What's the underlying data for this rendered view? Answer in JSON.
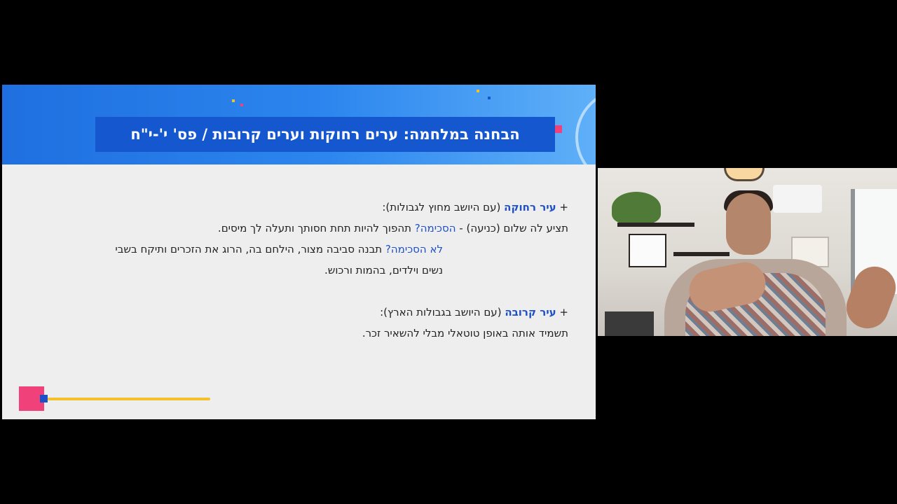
{
  "slide": {
    "title": "הבחנה במלחמה: ערים רחוקות וערים קרובות / פס' י'-י\"ח",
    "lines": [
      {
        "bold": "עיר רחוקה",
        "text": " (עם היושב מחוץ לגבולות):",
        "prefix": "+ "
      },
      {
        "text": "תציע לה שלום (כניעה)  - ",
        "blue": "הסכימה?",
        "tail": " תהפוך להיות תחת חסותך ותעלה לך מיסים."
      },
      {
        "blue": "לא הסכימה?",
        "text": " תבנה סביבה מצור, הילחם בה, הרוג את הזכרים ותיקח בשבי"
      },
      {
        "text": "נשים וילדים, בהמות ורכוש."
      },
      {
        "bold": "עיר קרובה",
        "text": " (עם היושב בגבולות הארץ):",
        "prefix": "+ "
      },
      {
        "text": "תשמיד אותה באופן טוטאלי מבלי להשאיר זכר."
      }
    ]
  },
  "colors": {
    "header_blue": "#1557cf",
    "accent_pink": "#f0417a",
    "accent_yellow": "#f5c12a",
    "text_blue": "#1e50c8"
  },
  "webcam": {
    "icon": "webcam-video-feed"
  }
}
